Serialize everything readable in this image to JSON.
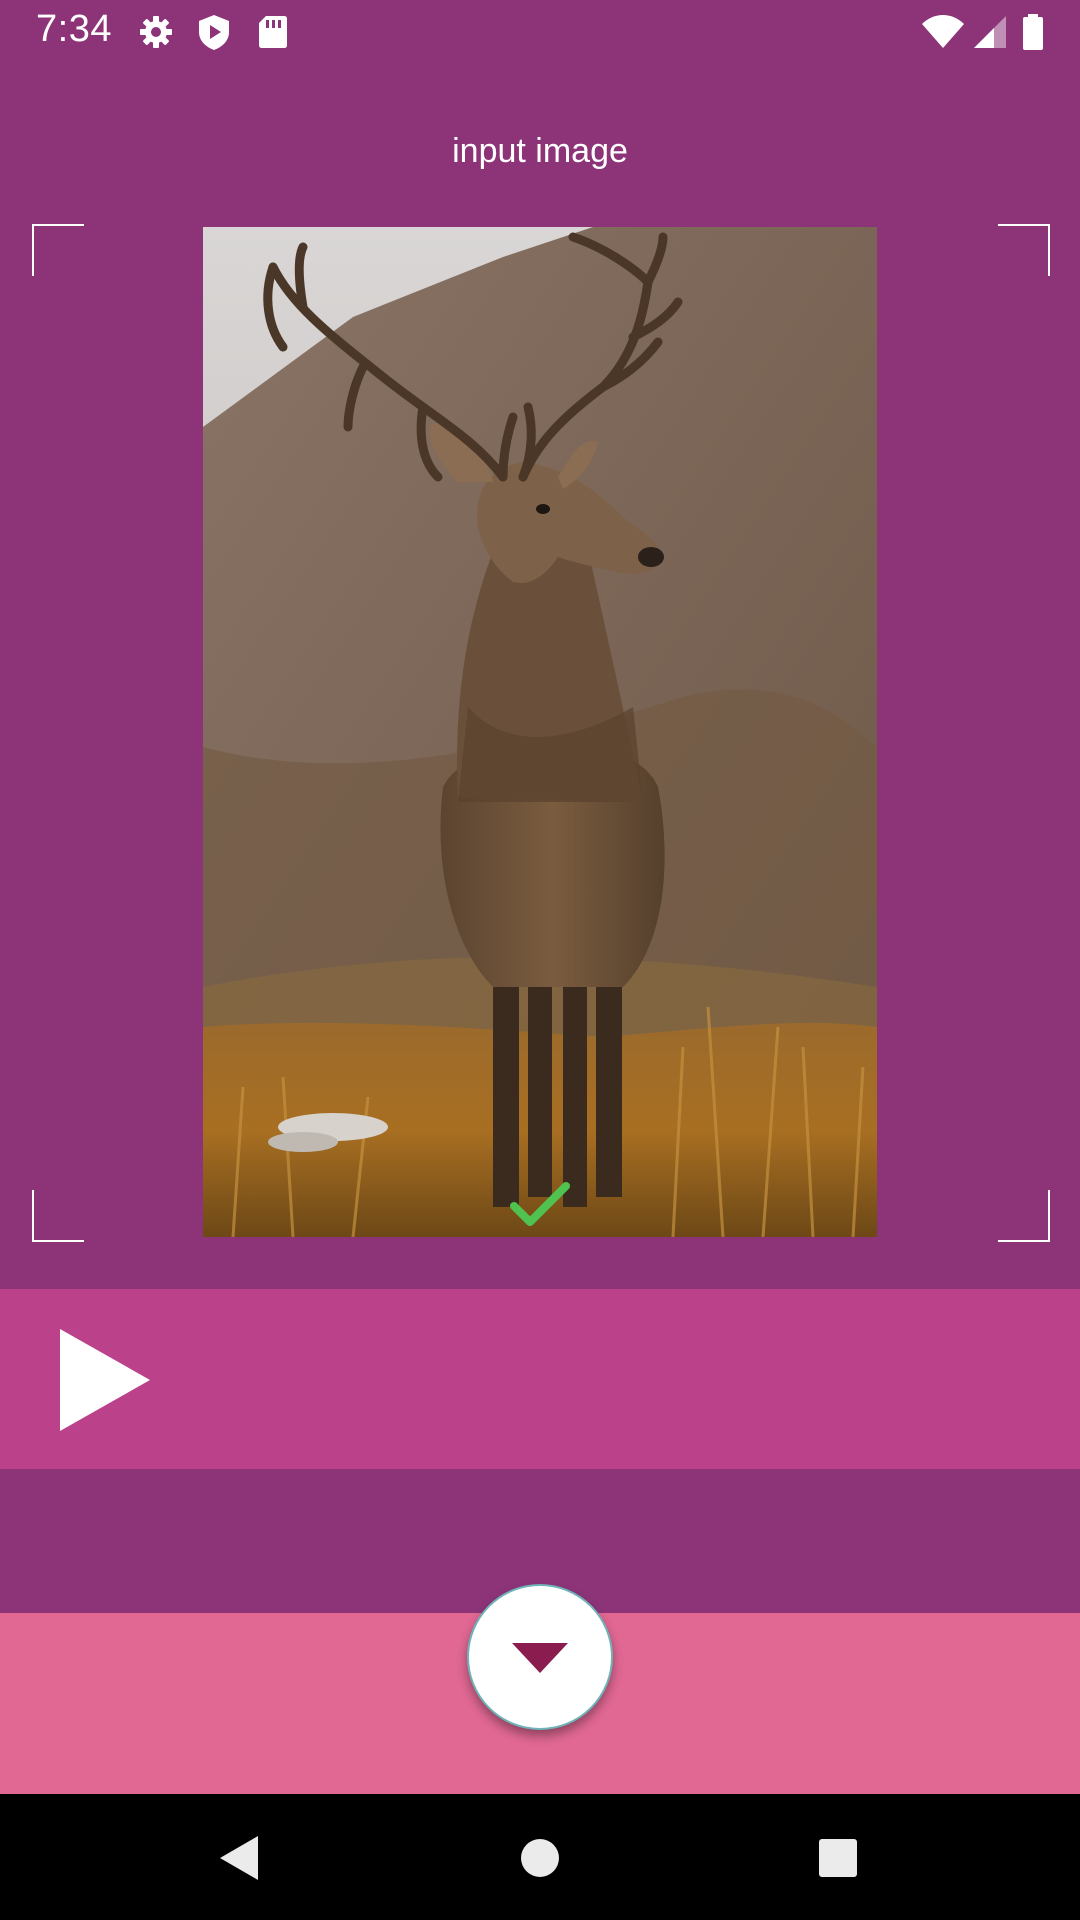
{
  "status_bar": {
    "time": "7:34",
    "icons": [
      "gear-icon",
      "shield-play-icon",
      "sd-card-icon",
      "wifi-icon",
      "cellular-signal-icon",
      "battery-icon"
    ]
  },
  "screen": {
    "title": "input image"
  },
  "image": {
    "subject": "red deer stag in grassy highland landscape",
    "badge_icon": "checkmark-icon"
  },
  "controls": {
    "play_icon": "play-icon",
    "fab_icon": "triangle-down-icon"
  },
  "navigation": {
    "back_icon": "back-triangle-icon",
    "home_icon": "home-circle-icon",
    "recents_icon": "recents-square-icon"
  },
  "colors": {
    "background": "#8d3479",
    "play_bar": "#bb428a",
    "bottom_panel": "#e06893",
    "fab_arrow": "#8b1c4f",
    "check": "#4fc24f"
  }
}
